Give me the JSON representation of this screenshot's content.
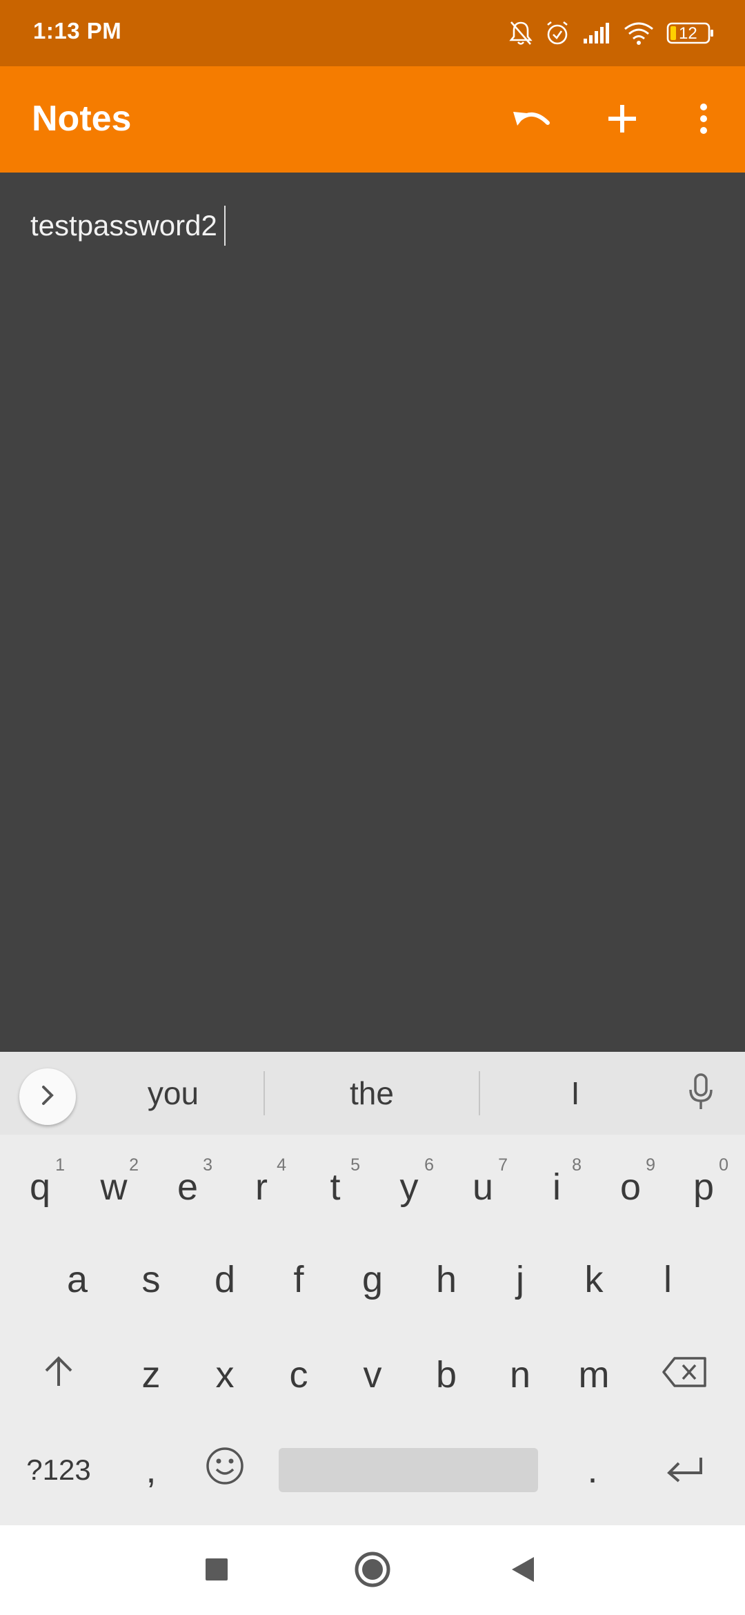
{
  "status_bar": {
    "time": "1:13 PM",
    "battery": "12",
    "icons": [
      "bell-muted-icon",
      "alarm-icon",
      "signal-icon",
      "wifi-icon",
      "battery-icon"
    ]
  },
  "app_bar": {
    "title": "Notes",
    "actions": [
      "undo-icon",
      "add-icon",
      "more-vert-icon"
    ]
  },
  "editor": {
    "text": "testpassword2"
  },
  "keyboard": {
    "suggestions": [
      "you",
      "the",
      "I"
    ],
    "row1": [
      {
        "label": "q",
        "num": "1"
      },
      {
        "label": "w",
        "num": "2"
      },
      {
        "label": "e",
        "num": "3"
      },
      {
        "label": "r",
        "num": "4"
      },
      {
        "label": "t",
        "num": "5"
      },
      {
        "label": "y",
        "num": "6"
      },
      {
        "label": "u",
        "num": "7"
      },
      {
        "label": "i",
        "num": "8"
      },
      {
        "label": "o",
        "num": "9"
      },
      {
        "label": "p",
        "num": "0"
      }
    ],
    "row2": [
      "a",
      "s",
      "d",
      "f",
      "g",
      "h",
      "j",
      "k",
      "l"
    ],
    "row3": [
      "z",
      "x",
      "c",
      "v",
      "b",
      "n",
      "m"
    ],
    "symbols_label": "?123",
    "comma": ",",
    "period": "."
  },
  "colors": {
    "status_bar": "#c96400",
    "app_bar": "#f57c00",
    "editor_bg": "#424242",
    "keyboard_bg": "#ececec"
  }
}
